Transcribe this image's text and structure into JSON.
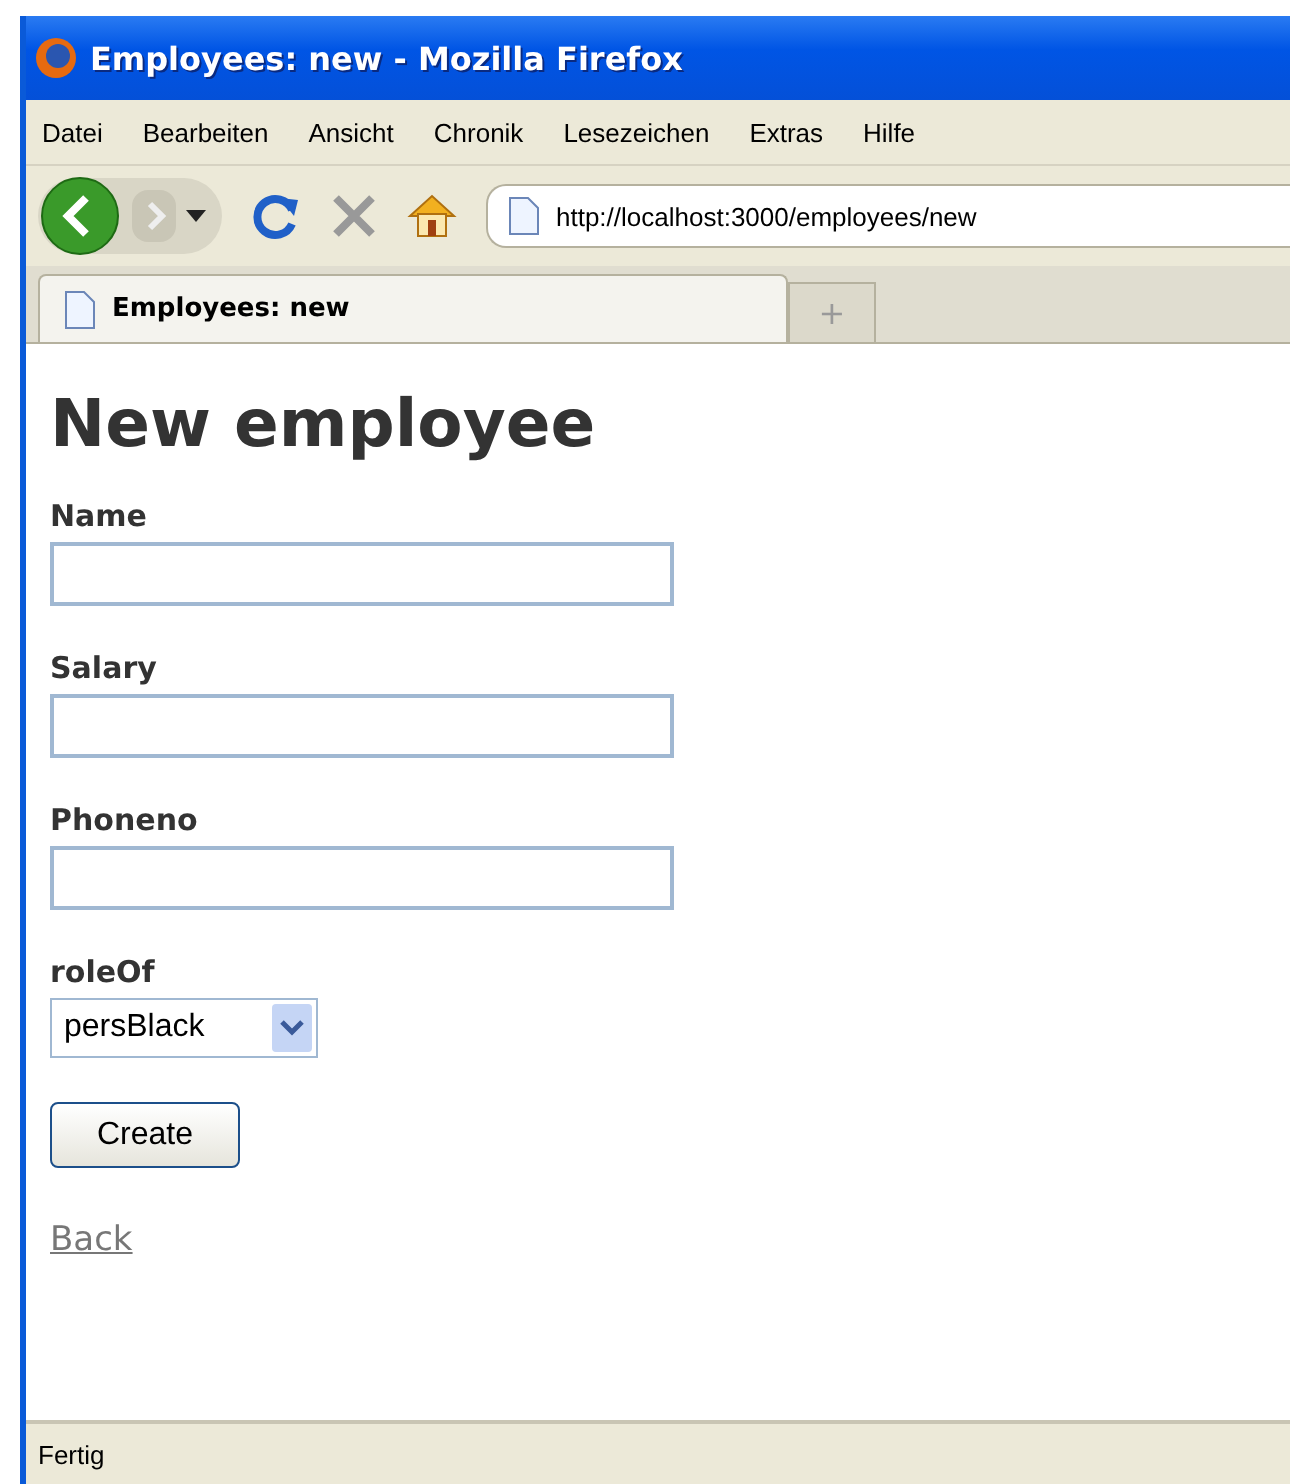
{
  "window": {
    "title": "Employees: new - Mozilla Firefox"
  },
  "menu": [
    "Datei",
    "Bearbeiten",
    "Ansicht",
    "Chronik",
    "Lesezeichen",
    "Extras",
    "Hilfe"
  ],
  "address_bar": {
    "value": "http://localhost:3000/employees/new"
  },
  "tabs": [
    {
      "label": "Employees: new",
      "selected": true
    }
  ],
  "new_tab": "+",
  "page": {
    "heading": "New employee",
    "fields": [
      {
        "kind": "text",
        "label": "Name"
      },
      {
        "kind": "text",
        "label": "Salary"
      },
      {
        "kind": "text",
        "label": "Phoneno"
      },
      {
        "kind": "select",
        "label": "roleOf",
        "value": "persBlack"
      }
    ],
    "submit": "Create",
    "back_link": "Back"
  },
  "status_bar": "Fertig"
}
